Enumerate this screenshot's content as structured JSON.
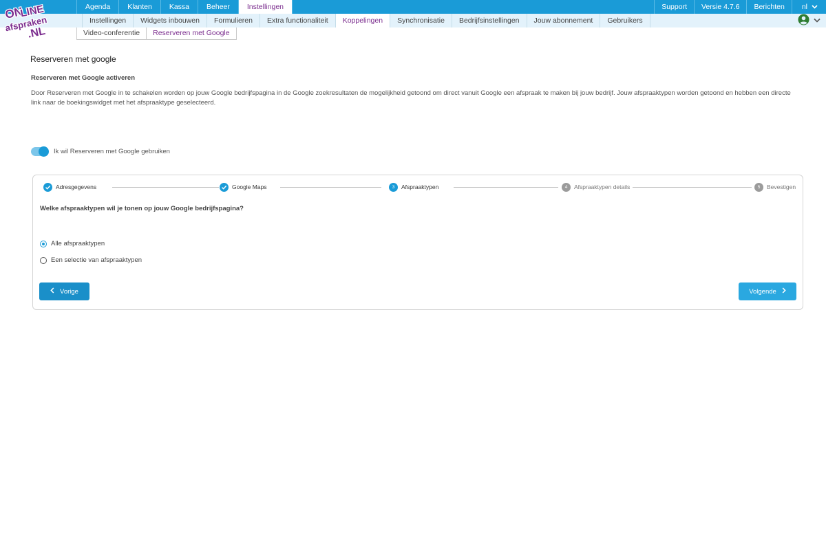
{
  "top_nav": {
    "items": [
      {
        "label": "Agenda"
      },
      {
        "label": "Klanten"
      },
      {
        "label": "Kassa"
      },
      {
        "label": "Beheer"
      },
      {
        "label": "Instellingen",
        "active": true
      }
    ],
    "right": {
      "support": "Support",
      "version": "Versie 4.7.6",
      "messages": "Berichten",
      "language": "nl"
    }
  },
  "sub_nav": {
    "items": [
      {
        "label": "Instellingen"
      },
      {
        "label": "Widgets inbouwen"
      },
      {
        "label": "Formulieren"
      },
      {
        "label": "Extra functionaliteit"
      },
      {
        "label": "Koppelingen",
        "active": true
      },
      {
        "label": "Synchronisatie"
      },
      {
        "label": "Bedrijfsinstellingen"
      },
      {
        "label": "Jouw abonnement"
      },
      {
        "label": "Gebruikers"
      }
    ]
  },
  "third_nav": {
    "items": [
      {
        "label": "Video-conferentie"
      },
      {
        "label": "Reserveren met Google",
        "active": true
      }
    ]
  },
  "logo": {
    "line1": "ON",
    "line2": "LINE",
    "line3": "afspraken",
    "line4": ".NL"
  },
  "page": {
    "title": "Reserveren met google",
    "section_title": "Reserveren met Google activeren",
    "description": "Door Reserveren met Google in te schakelen worden op jouw Google bedrijfspagina in de Google zoekresultaten de mogelijkheid getoond om direct vanuit Google een afspraak te maken bij jouw bedrijf. Jouw afspraaktypen worden getoond en hebben een directe link naar de boekingswidget met het afspraaktype geselecteerd.",
    "toggle_label": "Ik wil Reserveren met Google gebruiken",
    "toggle_on": true
  },
  "wizard": {
    "steps": [
      {
        "number": "1",
        "label": "Adresgegevens",
        "state": "done"
      },
      {
        "number": "2",
        "label": "Google Maps",
        "state": "done"
      },
      {
        "number": "3",
        "label": "Afspraaktypen",
        "state": "current"
      },
      {
        "number": "4",
        "label": "Afspraaktypen details",
        "state": "todo"
      },
      {
        "number": "5",
        "label": "Bevestigen",
        "state": "todo"
      }
    ],
    "question": "Welke afspraaktypen wil je tonen op jouw Google bedrijfspagina?",
    "options": [
      {
        "label": "Alle afspraaktypen",
        "checked": true
      },
      {
        "label": "Een selectie van afspraaktypen",
        "checked": false
      }
    ],
    "prev_label": "Vorige",
    "next_label": "Volgende"
  },
  "colors": {
    "primary": "#1a9bd7",
    "accent": "#7b2d8e",
    "subnav_bg": "#e3f2fb",
    "user_icon": "#2e7d32"
  }
}
